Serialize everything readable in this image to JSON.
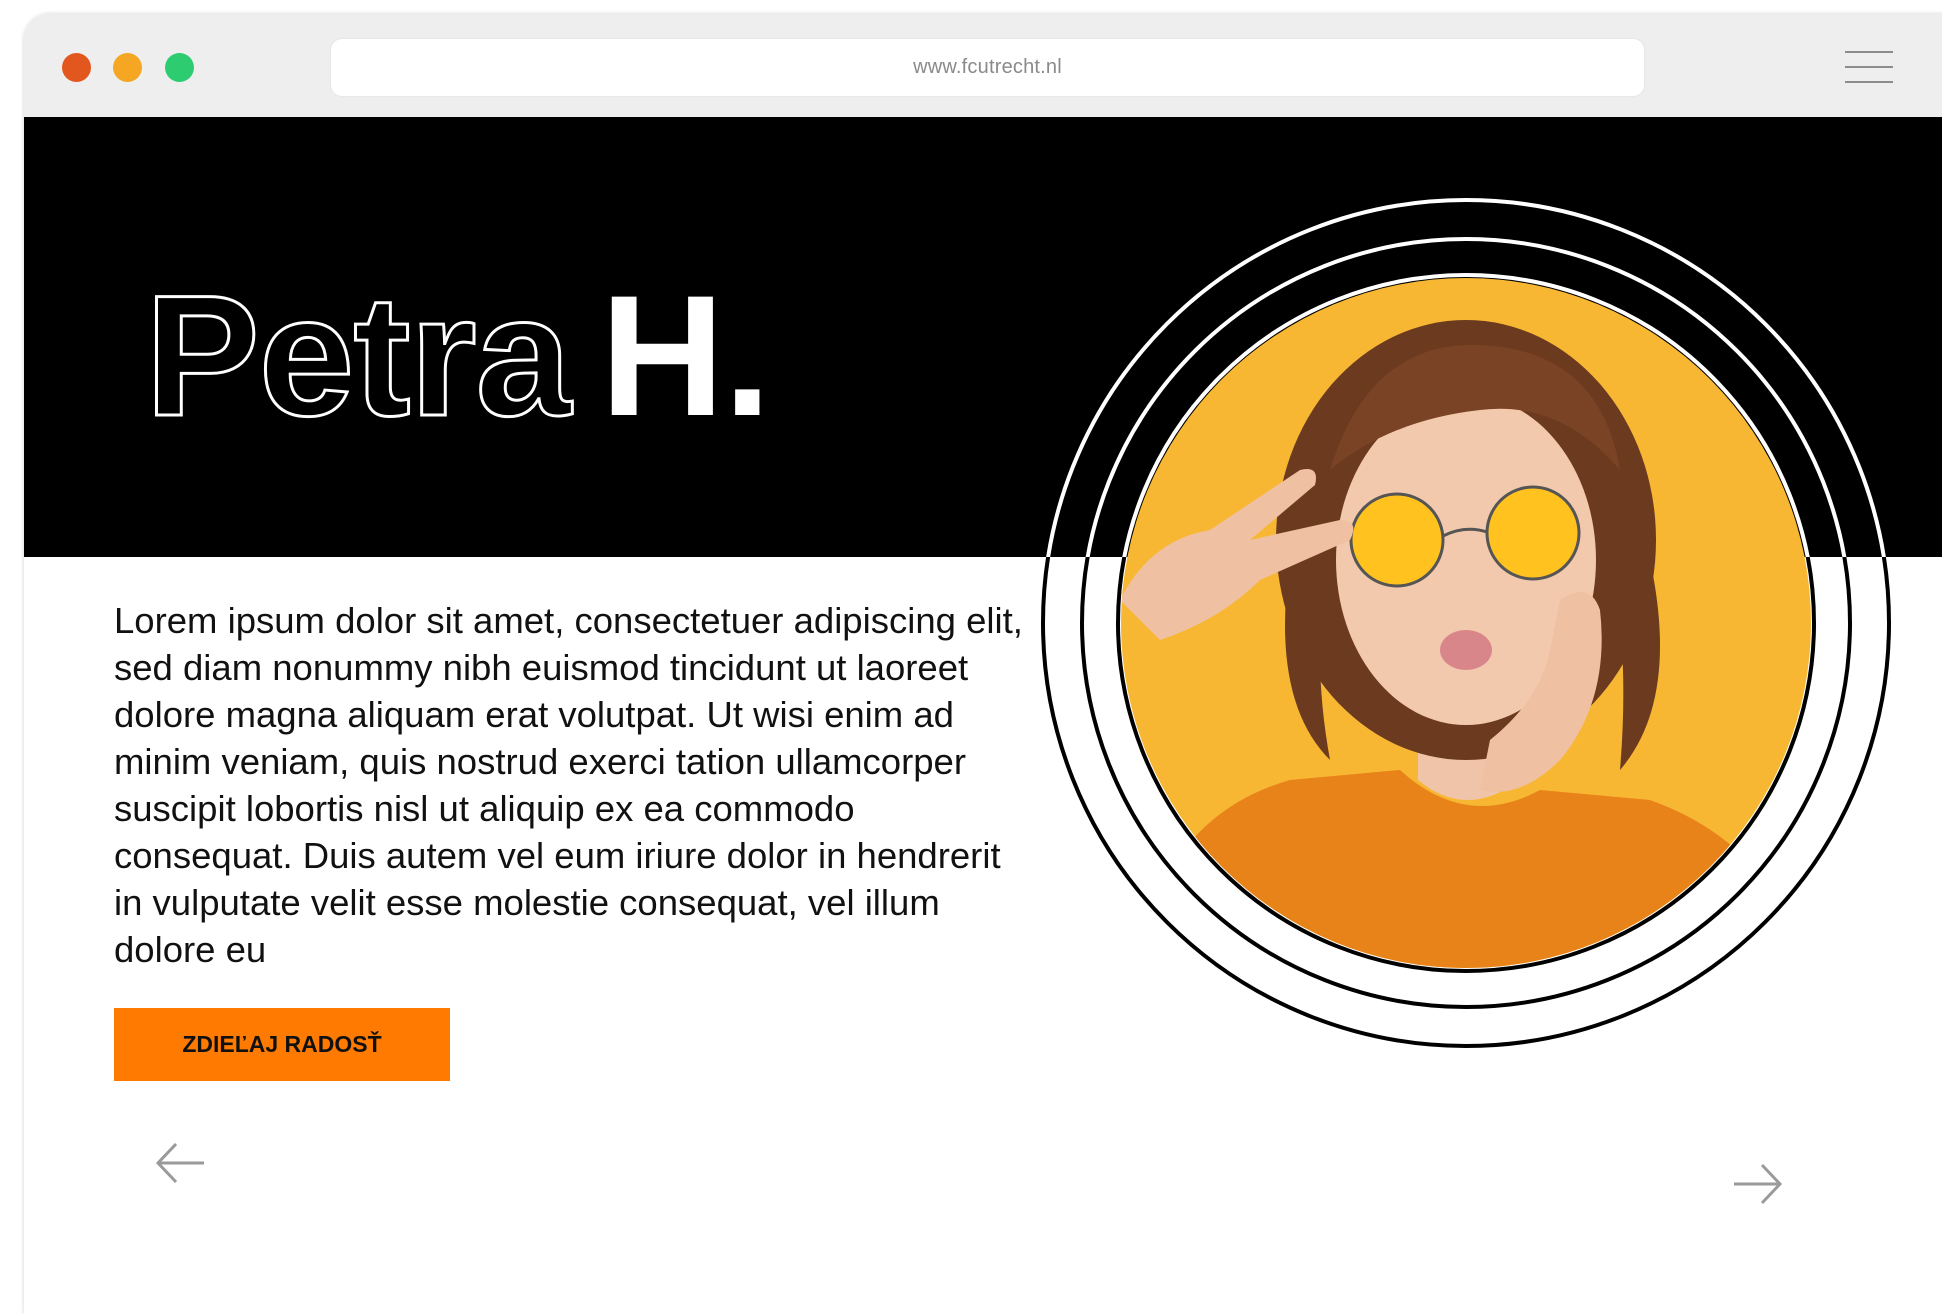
{
  "browser": {
    "url": "www.fcutrecht.nl",
    "colors": {
      "close": "#e2571e",
      "minimize": "#f5a623",
      "maximize": "#2ecc71"
    }
  },
  "hero": {
    "first_name": "Petra",
    "last_name": "H."
  },
  "bio": {
    "text": "Lorem ipsum dolor sit amet, consectetuer adipiscing elit, sed diam nonummy nibh euismod tincidunt ut laoreet dolore magna aliquam erat volutpat. Ut wisi enim ad minim veniam, quis nostrud exerci tation ullamcorper suscipit lobortis nisl ut aliquip ex ea commodo consequat. Duis autem vel eum iriure dolor in hendrerit in vulputate velit esse molestie consequat, vel illum dolore eu"
  },
  "cta": {
    "label": "ZDIEĽAJ RADOSŤ",
    "color": "#ff7a00"
  },
  "navigation": {
    "prev_icon": "arrow-left-icon",
    "next_icon": "arrow-right-icon"
  },
  "portrait": {
    "background_color": "#f7b733",
    "sweater_color": "#e8831a",
    "lens_color": "#ffc21f"
  }
}
